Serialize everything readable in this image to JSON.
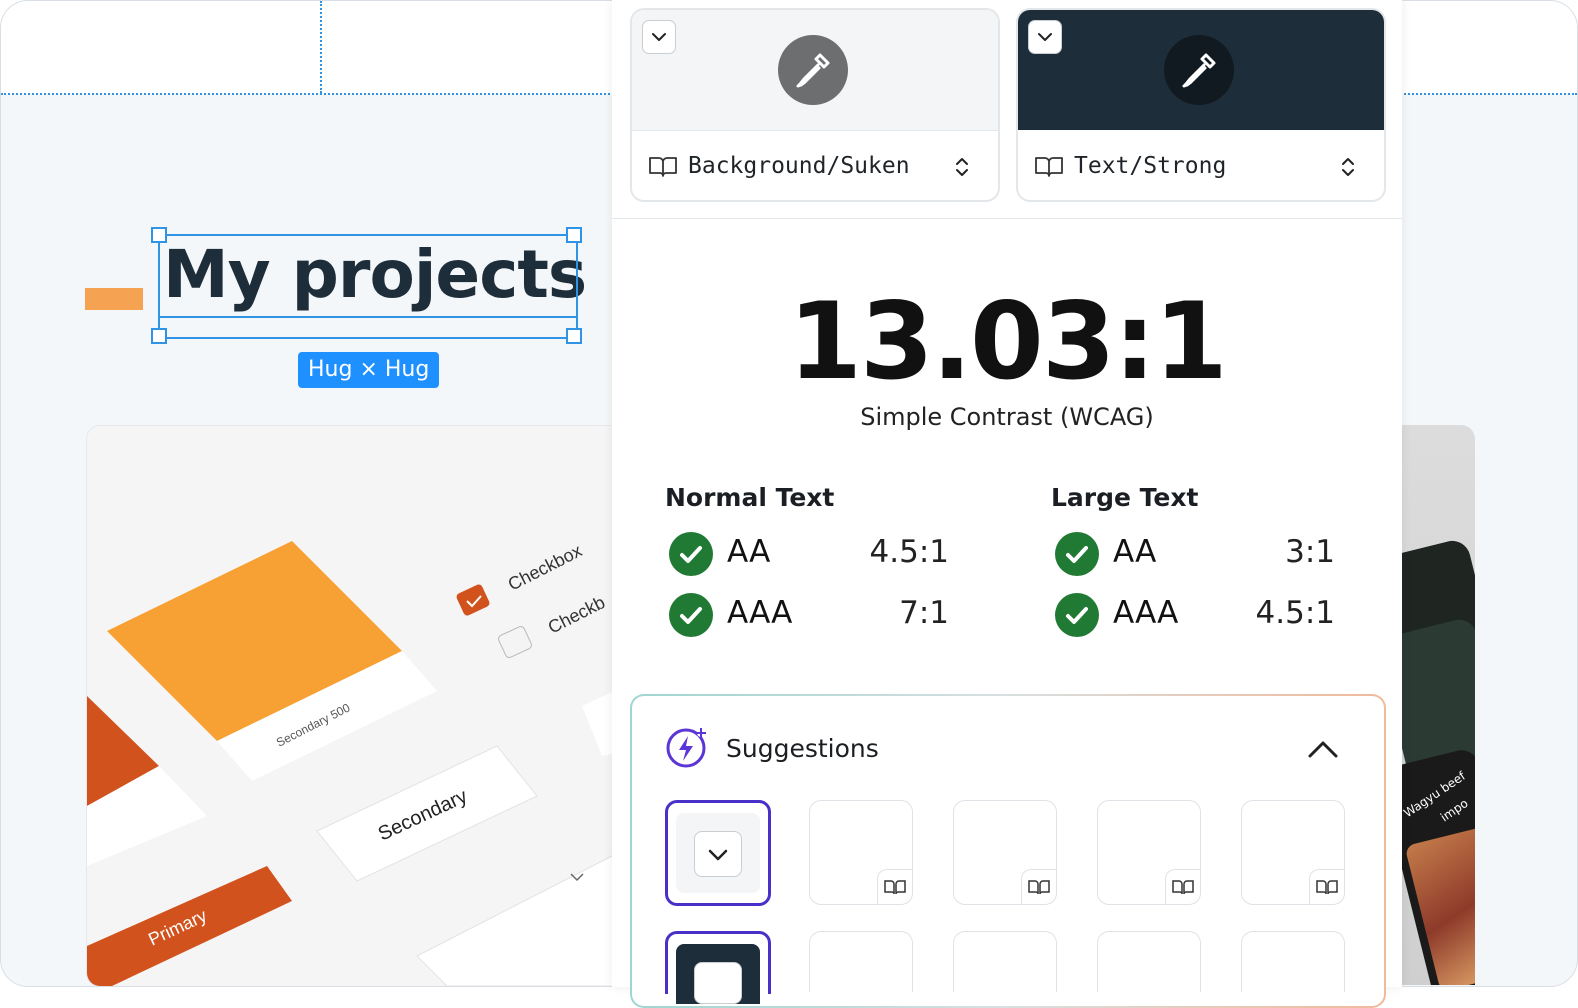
{
  "canvas": {
    "title": "My projects",
    "hug_badge": "Hug × Hug"
  },
  "preview": {
    "checkbox_1": "Checkbox",
    "checkbox_2": "Checkb",
    "swatch_label": "Secondary 500",
    "secondary_button": "Secondary",
    "primary_button": "Primary",
    "phone_text_1": "Wagyu beef",
    "phone_text_2": "impo"
  },
  "contrast_panel": {
    "background_token": "Background/Suken",
    "text_token": "Text/Strong",
    "background_color": "#f3f5f6",
    "text_color": "#1e2d3a",
    "ratio": "13.03:1",
    "ratio_label": "Simple Contrast (WCAG)",
    "normal_text": {
      "heading": "Normal Text",
      "rows": [
        {
          "level": "AA",
          "value": "4.5:1",
          "pass": true
        },
        {
          "level": "AAA",
          "value": "7:1",
          "pass": true
        }
      ]
    },
    "large_text": {
      "heading": "Large Text",
      "rows": [
        {
          "level": "AA",
          "value": "3:1",
          "pass": true
        },
        {
          "level": "AAA",
          "value": "4.5:1",
          "pass": true
        }
      ]
    },
    "suggestions": {
      "title": "Suggestions",
      "expanded": true
    }
  },
  "colors": {
    "selection_blue": "#2f93e6",
    "accent_orange": "#f5a352",
    "pass_green": "#217a34",
    "suggestion_purple": "#4a2fc8"
  }
}
